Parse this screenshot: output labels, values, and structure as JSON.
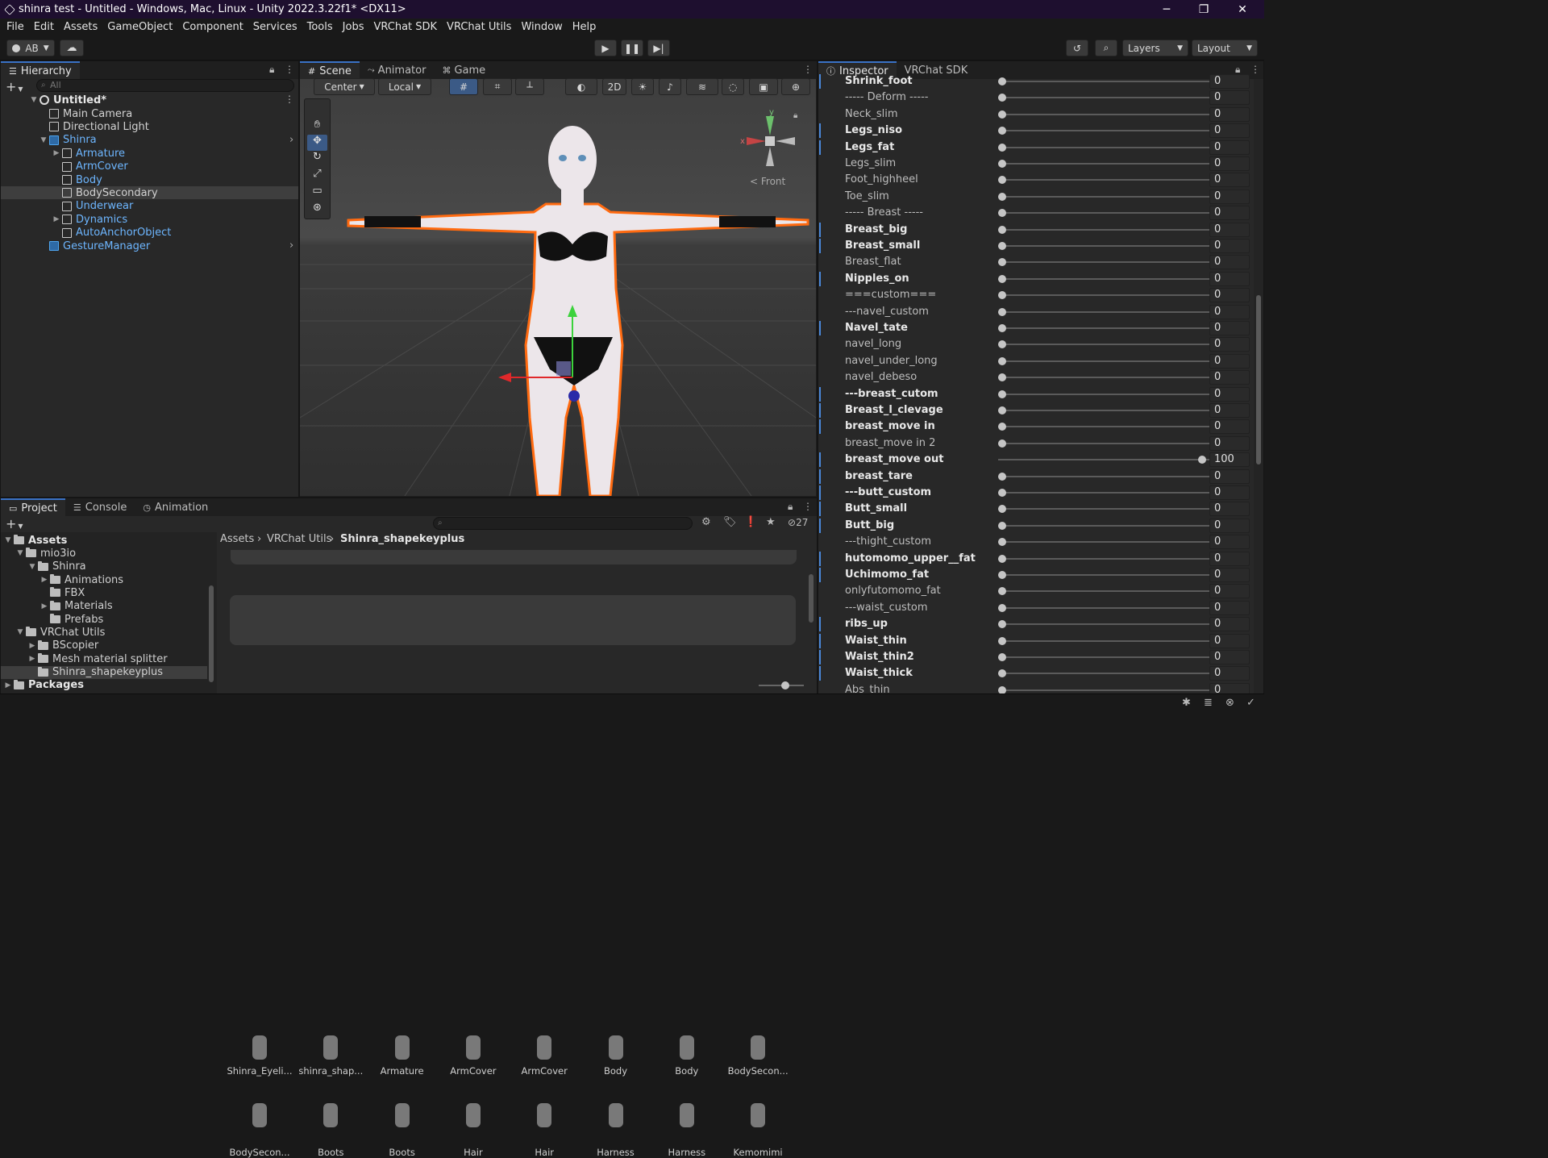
{
  "window": {
    "title": "shinra test - Untitled - Windows, Mac, Linux - Unity 2022.3.22f1* <DX11>",
    "minimize": "─",
    "maximize": "❐",
    "close": "✕"
  },
  "menu": [
    "File",
    "Edit",
    "Assets",
    "GameObject",
    "Component",
    "Services",
    "Tools",
    "Jobs",
    "VRChat SDK",
    "VRChat Utils",
    "Window",
    "Help"
  ],
  "toolbar": {
    "account": "AB",
    "layers": "Layers",
    "layout": "Layout"
  },
  "hierarchy": {
    "tab": "Hierarchy",
    "search_placeholder": "All",
    "scene": "Untitled*",
    "items": [
      {
        "label": "Main Camera",
        "depth": 1,
        "blue": false,
        "expand": false
      },
      {
        "label": "Directional Light",
        "depth": 1,
        "blue": false,
        "expand": false
      },
      {
        "label": "Shinra",
        "depth": 1,
        "blue": true,
        "expand": true
      },
      {
        "label": "Armature",
        "depth": 2,
        "blue": true,
        "expand": true
      },
      {
        "label": "ArmCover",
        "depth": 2,
        "blue": true,
        "expand": false
      },
      {
        "label": "Body",
        "depth": 2,
        "blue": true,
        "expand": false
      },
      {
        "label": "BodySecondary",
        "depth": 2,
        "blue": false,
        "expand": false,
        "selected": true
      },
      {
        "label": "Underwear",
        "depth": 2,
        "blue": true,
        "expand": false
      },
      {
        "label": "Dynamics",
        "depth": 2,
        "blue": true,
        "expand": true
      },
      {
        "label": "AutoAnchorObject",
        "depth": 2,
        "blue": true,
        "expand": false
      },
      {
        "label": "GestureManager",
        "depth": 1,
        "blue": true,
        "expand": false
      }
    ]
  },
  "scene_tabs": [
    "Scene",
    "Animator",
    "Game"
  ],
  "scene_toolbar": {
    "pivot": "Center",
    "space": "Local",
    "mode2d": "2D"
  },
  "gizmo": {
    "view": "< Front",
    "x": "x",
    "y": "y"
  },
  "bottom_tabs": [
    "Project",
    "Console",
    "Animation"
  ],
  "project": {
    "tree": [
      {
        "label": "Assets",
        "depth": 0,
        "bold": true,
        "arrow": "▼"
      },
      {
        "label": "mio3io",
        "depth": 1,
        "arrow": "▼"
      },
      {
        "label": "Shinra",
        "depth": 2,
        "arrow": "▼"
      },
      {
        "label": "Animations",
        "depth": 3,
        "arrow": "▶"
      },
      {
        "label": "FBX",
        "depth": 3,
        "arrow": ""
      },
      {
        "label": "Materials",
        "depth": 3,
        "arrow": "▶"
      },
      {
        "label": "Prefabs",
        "depth": 3,
        "arrow": ""
      },
      {
        "label": "VRChat Utils",
        "depth": 1,
        "arrow": "▼"
      },
      {
        "label": "BScopier",
        "depth": 2,
        "arrow": "▶"
      },
      {
        "label": "Mesh material splitter",
        "depth": 2,
        "arrow": "▶"
      },
      {
        "label": "Shinra_shapekeyplus",
        "depth": 2,
        "arrow": "",
        "selected": true
      },
      {
        "label": "Packages",
        "depth": 0,
        "bold": true,
        "arrow": "▶"
      }
    ],
    "breadcrumb": [
      "Assets",
      "VRChat Utils",
      "Shinra_shapekeyplus"
    ],
    "hidden_count": "27",
    "row1": [
      "Shinra_Eyeli...",
      "shinra_shap...",
      "Armature",
      "ArmCover",
      "ArmCover",
      "Body",
      "Body",
      "BodySecon..."
    ],
    "row2": [
      "BodySecon...",
      "Boots",
      "Boots",
      "Hair",
      "Hair",
      "Harness",
      "Harness",
      "Kemomimi"
    ]
  },
  "inspector": {
    "tabs": [
      "Inspector",
      "VRChat SDK"
    ],
    "blendshapes": [
      {
        "name": "Shrink_foot",
        "value": "0",
        "bold": true,
        "pos": 0
      },
      {
        "name": "----- Deform -----",
        "value": "0",
        "bold": false,
        "pos": 0
      },
      {
        "name": "Neck_slim",
        "value": "0",
        "bold": false,
        "pos": 0
      },
      {
        "name": "Legs_niso",
        "value": "0",
        "bold": true,
        "pos": 0
      },
      {
        "name": "Legs_fat",
        "value": "0",
        "bold": true,
        "pos": 0
      },
      {
        "name": "Legs_slim",
        "value": "0",
        "bold": false,
        "pos": 0
      },
      {
        "name": "Foot_highheel",
        "value": "0",
        "bold": false,
        "pos": 0
      },
      {
        "name": "Toe_slim",
        "value": "0",
        "bold": false,
        "pos": 0
      },
      {
        "name": "----- Breast -----",
        "value": "0",
        "bold": false,
        "pos": 0
      },
      {
        "name": "Breast_big",
        "value": "0",
        "bold": true,
        "pos": 0
      },
      {
        "name": "Breast_small",
        "value": "0",
        "bold": true,
        "pos": 0
      },
      {
        "name": "Breast_flat",
        "value": "0",
        "bold": false,
        "pos": 0
      },
      {
        "name": "Nipples_on",
        "value": "0",
        "bold": true,
        "pos": 0
      },
      {
        "name": "===custom===",
        "value": "0",
        "bold": false,
        "pos": 0
      },
      {
        "name": "---navel_custom",
        "value": "0",
        "bold": false,
        "pos": 0
      },
      {
        "name": "Navel_tate",
        "value": "0",
        "bold": true,
        "pos": 0
      },
      {
        "name": "navel_long",
        "value": "0",
        "bold": false,
        "pos": 0
      },
      {
        "name": "navel_under_long",
        "value": "0",
        "bold": false,
        "pos": 0
      },
      {
        "name": "navel_debeso",
        "value": "0",
        "bold": false,
        "pos": 0
      },
      {
        "name": "---breast_cutom",
        "value": "0",
        "bold": true,
        "pos": 0
      },
      {
        "name": "Breast_l_clevage",
        "value": "0",
        "bold": true,
        "pos": 0
      },
      {
        "name": "breast_move in",
        "value": "0",
        "bold": true,
        "pos": 0
      },
      {
        "name": "breast_move in 2",
        "value": "0",
        "bold": false,
        "pos": 0
      },
      {
        "name": "breast_move out",
        "value": "100",
        "bold": true,
        "pos": 1
      },
      {
        "name": "breast_tare",
        "value": "0",
        "bold": true,
        "pos": 0
      },
      {
        "name": "---butt_custom",
        "value": "0",
        "bold": true,
        "pos": 0
      },
      {
        "name": "Butt_small",
        "value": "0",
        "bold": true,
        "pos": 0
      },
      {
        "name": "Butt_big",
        "value": "0",
        "bold": true,
        "pos": 0
      },
      {
        "name": "---thight_custom",
        "value": "0",
        "bold": false,
        "pos": 0
      },
      {
        "name": "hutomomo_upper__fat",
        "value": "0",
        "bold": true,
        "pos": 0
      },
      {
        "name": "Uchimomo_fat",
        "value": "0",
        "bold": true,
        "pos": 0
      },
      {
        "name": "onlyfutomomo_fat",
        "value": "0",
        "bold": false,
        "pos": 0
      },
      {
        "name": "---waist_custom",
        "value": "0",
        "bold": false,
        "pos": 0
      },
      {
        "name": "ribs_up",
        "value": "0",
        "bold": true,
        "pos": 0
      },
      {
        "name": "Waist_thin",
        "value": "0",
        "bold": true,
        "pos": 0
      },
      {
        "name": "Waist_thin2",
        "value": "0",
        "bold": true,
        "pos": 0
      },
      {
        "name": "Waist_thick",
        "value": "0",
        "bold": true,
        "pos": 0
      },
      {
        "name": "Abs_thin",
        "value": "0",
        "bold": false,
        "pos": 0
      }
    ]
  }
}
